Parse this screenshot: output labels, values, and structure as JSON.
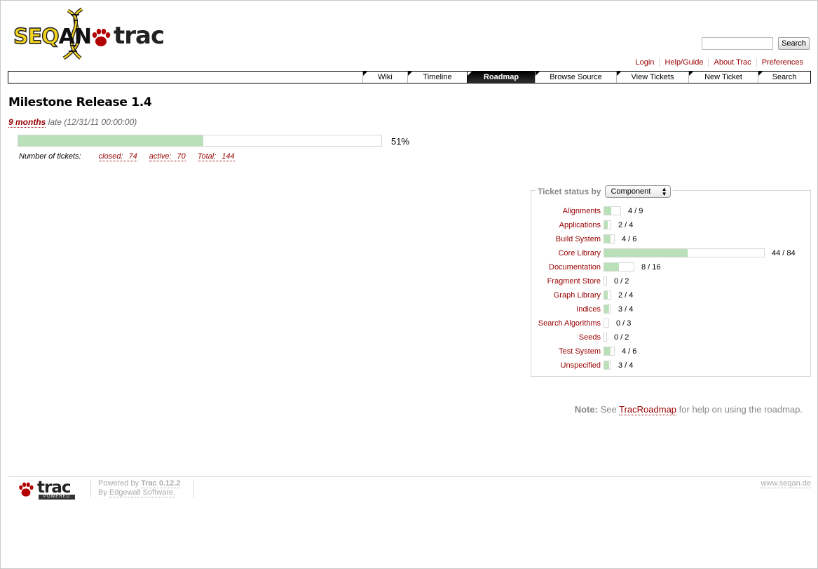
{
  "logo": {
    "seqan_prefix": "SEQ",
    "seqan_suffix": "AN",
    "trac": "trac"
  },
  "search": {
    "value": "",
    "button_label": "Search"
  },
  "metanav": [
    "Login",
    "Help/Guide",
    "About Trac",
    "Preferences"
  ],
  "mainnav": {
    "tabs": [
      "Wiki",
      "Timeline",
      "Roadmap",
      "Browse Source",
      "View Tickets",
      "New Ticket",
      "Search"
    ],
    "active": "Roadmap"
  },
  "milestone": {
    "title": "Milestone Release 1.4",
    "late_label": "9 months",
    "late_word": "late",
    "date": "(12/31/11 00:00:00)",
    "progress_fraction": 0.51,
    "percent_label": "51%",
    "tickets_label": "Number of tickets:",
    "closed_label": "closed:",
    "closed": "74",
    "active_label": "active:",
    "active": "70",
    "total_label": "Total:",
    "total": "144"
  },
  "ticket_status": {
    "legend": "Ticket status by",
    "group_by": "Component",
    "rows": [
      {
        "name": "Alignments",
        "closed": 4,
        "total": 9,
        "label": "4 / 9"
      },
      {
        "name": "Applications",
        "closed": 2,
        "total": 4,
        "label": "2 / 4"
      },
      {
        "name": "Build System",
        "closed": 4,
        "total": 6,
        "label": "4 / 6"
      },
      {
        "name": "Core Library",
        "closed": 44,
        "total": 84,
        "label": "44 / 84"
      },
      {
        "name": "Documentation",
        "closed": 8,
        "total": 16,
        "label": "8 / 16"
      },
      {
        "name": "Fragment Store",
        "closed": 0,
        "total": 2,
        "label": "0 / 2"
      },
      {
        "name": "Graph Library",
        "closed": 2,
        "total": 4,
        "label": "2 / 4"
      },
      {
        "name": "Indices",
        "closed": 3,
        "total": 4,
        "label": "3 / 4"
      },
      {
        "name": "Search Algorithms",
        "closed": 0,
        "total": 3,
        "label": "0 / 3"
      },
      {
        "name": "Seeds",
        "closed": 0,
        "total": 2,
        "label": "0 / 2"
      },
      {
        "name": "Test System",
        "closed": 4,
        "total": 6,
        "label": "4 / 6"
      },
      {
        "name": "Unspecified",
        "closed": 3,
        "total": 4,
        "label": "3 / 4"
      }
    ]
  },
  "note": {
    "prefix": "Note:",
    "see": "See",
    "link": "TracRoadmap",
    "suffix": "for help on using the roadmap."
  },
  "footer": {
    "logo_word": "trac",
    "logo_badge": "POWERED",
    "powered_by": "Powered by",
    "trac_version": "Trac 0.12.2",
    "by": "By",
    "edgewall": "Edgewall Software.",
    "site": "www.seqan.de"
  },
  "colors": {
    "link": "#990000",
    "progress": "#bae0ba",
    "nav_active": "#000000"
  }
}
